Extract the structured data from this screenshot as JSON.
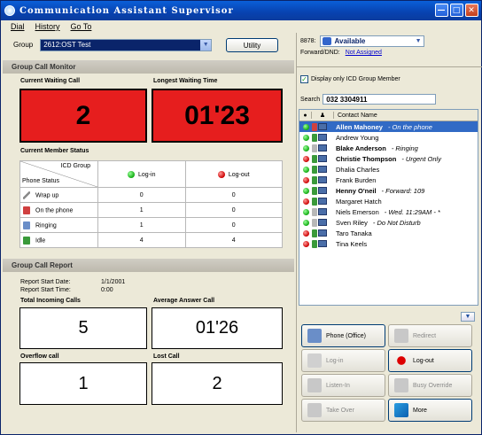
{
  "window": {
    "title": "Communication Assistant Supervisor"
  },
  "menu": {
    "dial": "Dial",
    "history": "History",
    "goto": "Go To"
  },
  "group": {
    "label": "Group",
    "value": "2612:OST Test",
    "utility_button": "Utility"
  },
  "monitor": {
    "section_title": "Group Call Monitor",
    "current_waiting_label": "Current Waiting Call",
    "current_waiting_value": "2",
    "longest_waiting_label": "Longest Waiting Time",
    "longest_waiting_value": "01'23",
    "member_status_title": "Current Member Status",
    "table": {
      "corner_top": "ICD Group",
      "corner_bottom": "Phone Status",
      "col_login": "Log-in",
      "col_logout": "Log-out",
      "rows": [
        {
          "label": "Wrap up",
          "login": "0",
          "logout": "0"
        },
        {
          "label": "On the phone",
          "login": "1",
          "logout": "0"
        },
        {
          "label": "Ringing",
          "login": "1",
          "logout": "0"
        },
        {
          "label": "Idle",
          "login": "4",
          "logout": "4"
        }
      ]
    }
  },
  "report": {
    "section_title": "Group Call Report",
    "start_date_label": "Report Start Date:",
    "start_date_value": "1/1/2001",
    "start_time_label": "Report Start Time:",
    "start_time_value": "0:00",
    "total_incoming_label": "Total Incoming Calls",
    "total_incoming_value": "5",
    "avg_answer_label": "Average Answer Call",
    "avg_answer_value": "01'26",
    "overflow_label": "Overflow call",
    "overflow_value": "1",
    "lost_label": "Lost Call",
    "lost_value": "2"
  },
  "status": {
    "extension": "8878:",
    "presence": "Available",
    "forward_label": "Forward/DND:",
    "forward_value": "Not Assigned"
  },
  "filter": {
    "display_icd_only": "Display only ICD Group Member",
    "search_label": "Search",
    "search_value": "032 3304911"
  },
  "contacts": {
    "header_name": "Contact Name",
    "rows": [
      {
        "name": "Allen Mahoney",
        "status": "- On the phone",
        "bold": true
      },
      {
        "name": "Andrew Young",
        "status": "",
        "bold": false
      },
      {
        "name": "Blake Anderson",
        "status": "- Ringing",
        "bold": true
      },
      {
        "name": "Christie Thompson",
        "status": "- Urgent Only",
        "bold": true
      },
      {
        "name": "Dhalia Charles",
        "status": "",
        "bold": false
      },
      {
        "name": "Frank Burden",
        "status": "",
        "bold": false
      },
      {
        "name": "Henny O'neil",
        "status": "- Forward: 109",
        "bold": true
      },
      {
        "name": "Margaret Hatch",
        "status": "",
        "bold": false
      },
      {
        "name": "Niels Emerson",
        "status": "- Wed. 11:29AM - *",
        "bold": false
      },
      {
        "name": "Sven Riley",
        "status": "- Do Not Disturb",
        "bold": false
      },
      {
        "name": "Taro Tanaka",
        "status": "",
        "bold": false
      },
      {
        "name": "Tina Keels",
        "status": "",
        "bold": false
      }
    ]
  },
  "actions": {
    "phone_office": "Phone (Office)",
    "redirect": "Redirect",
    "login": "Log-in",
    "logout": "Log-out",
    "listen_in": "Listen-In",
    "busy_override": "Busy Override",
    "take_over": "Take Over",
    "more": "More"
  },
  "colors": {
    "alert_red": "#e61e1e",
    "selection_blue": "#316ac5",
    "title_blue": "#0842b0"
  }
}
